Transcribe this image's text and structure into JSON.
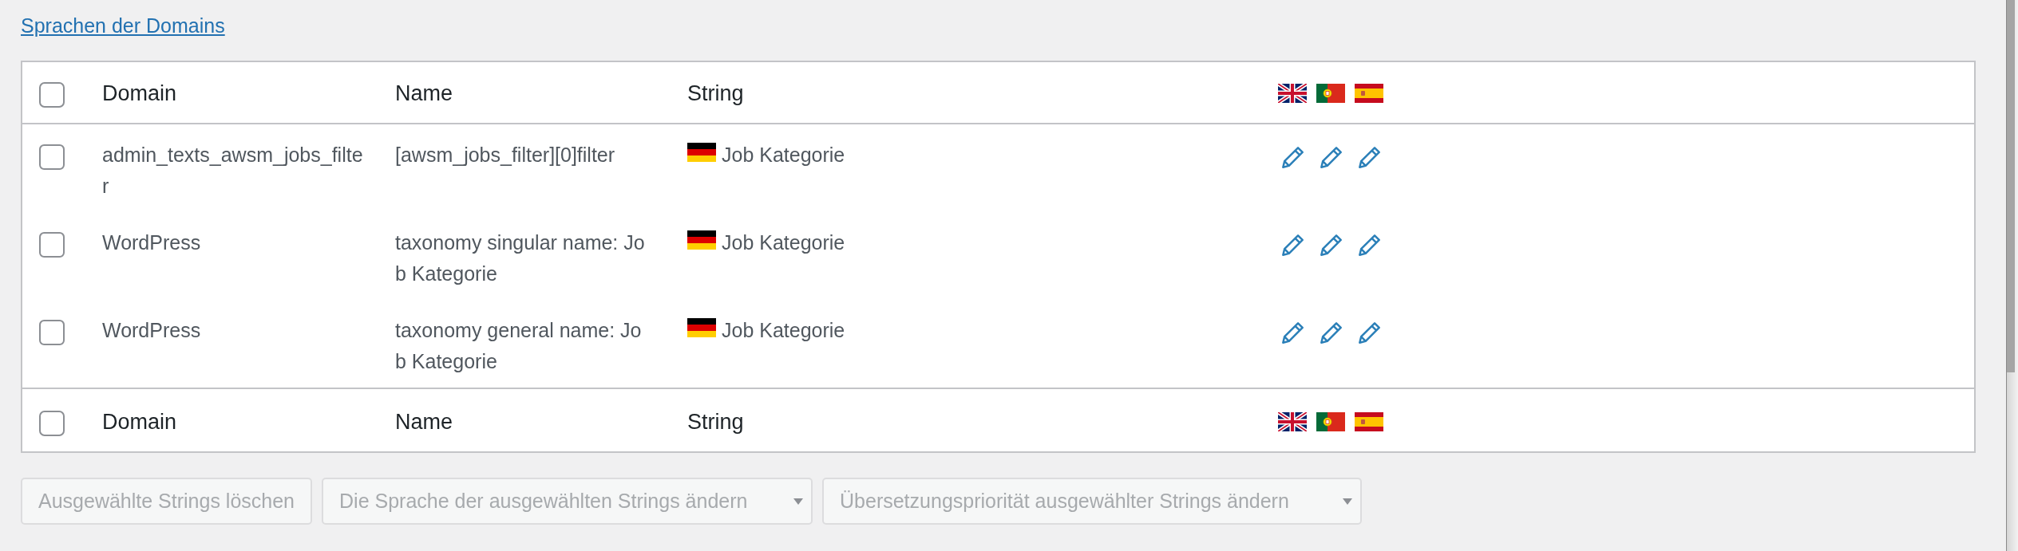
{
  "link": {
    "label": "Sprachen der Domains"
  },
  "table": {
    "header": {
      "checked": false,
      "columns": [
        "Domain",
        "Name",
        "String"
      ]
    },
    "rows": [
      {
        "checked": false,
        "domain": "admin_texts_awsm_jobs_filter",
        "name": "[awsm_jobs_filter][0]filter",
        "string": "Job Kategorie"
      },
      {
        "checked": false,
        "domain": "WordPress",
        "name": "taxonomy singular name: Job Kategorie",
        "string": "Job Kategorie"
      },
      {
        "checked": false,
        "domain": "WordPress",
        "name": "taxonomy general name: Job Kategorie",
        "string": "Job Kategorie"
      }
    ],
    "footer": {
      "checked": false,
      "columns": [
        "Domain",
        "Name",
        "String"
      ]
    }
  },
  "bulk_actions": [
    {
      "kind": "button",
      "label": "Ausgewählte Strings löschen",
      "disabled": true
    },
    {
      "kind": "dropdown",
      "value": "Die Sprache der ausgewählten Strings ändern",
      "disabled": true
    },
    {
      "kind": "dropdown",
      "value": "Übersetzungspriorität ausgewählter Strings ändern",
      "disabled": true
    }
  ]
}
